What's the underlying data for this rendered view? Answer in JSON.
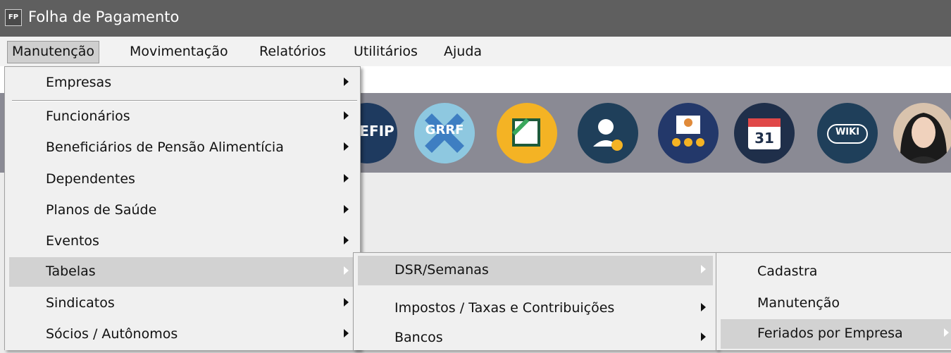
{
  "window": {
    "title": "Folha de Pagamento",
    "icon": "FP"
  },
  "menubar": [
    "Manutenção",
    "Movimentação",
    "Relatórios",
    "Utilitários",
    "Ajuda"
  ],
  "toolbar": {
    "sefip": "EFIP",
    "grrf": "GRRF",
    "wiki": "WIKI",
    "calendar": "31"
  },
  "menu1": {
    "empresas": "Empresas",
    "funcionarios": "Funcionários",
    "beneficiarios": "Beneficiários de Pensão Alimentícia",
    "dependentes": "Dependentes",
    "planos": "Planos de Saúde",
    "eventos": "Eventos",
    "tabelas": "Tabelas",
    "sindicatos": "Sindicatos",
    "socios": "Sócios / Autônomos"
  },
  "menu2": {
    "dsr": "DSR/Semanas",
    "impostos": "Impostos / Taxas e Contribuições",
    "bancos": "Bancos"
  },
  "menu3": {
    "cadastra": "Cadastra",
    "manutencao": "Manutenção",
    "feriados": "Feriados por Empresa"
  },
  "colors": {
    "titlebar": "#5f5f5f",
    "toolbar": "#8a8a94",
    "menu_highlight": "#d2d2d2"
  }
}
